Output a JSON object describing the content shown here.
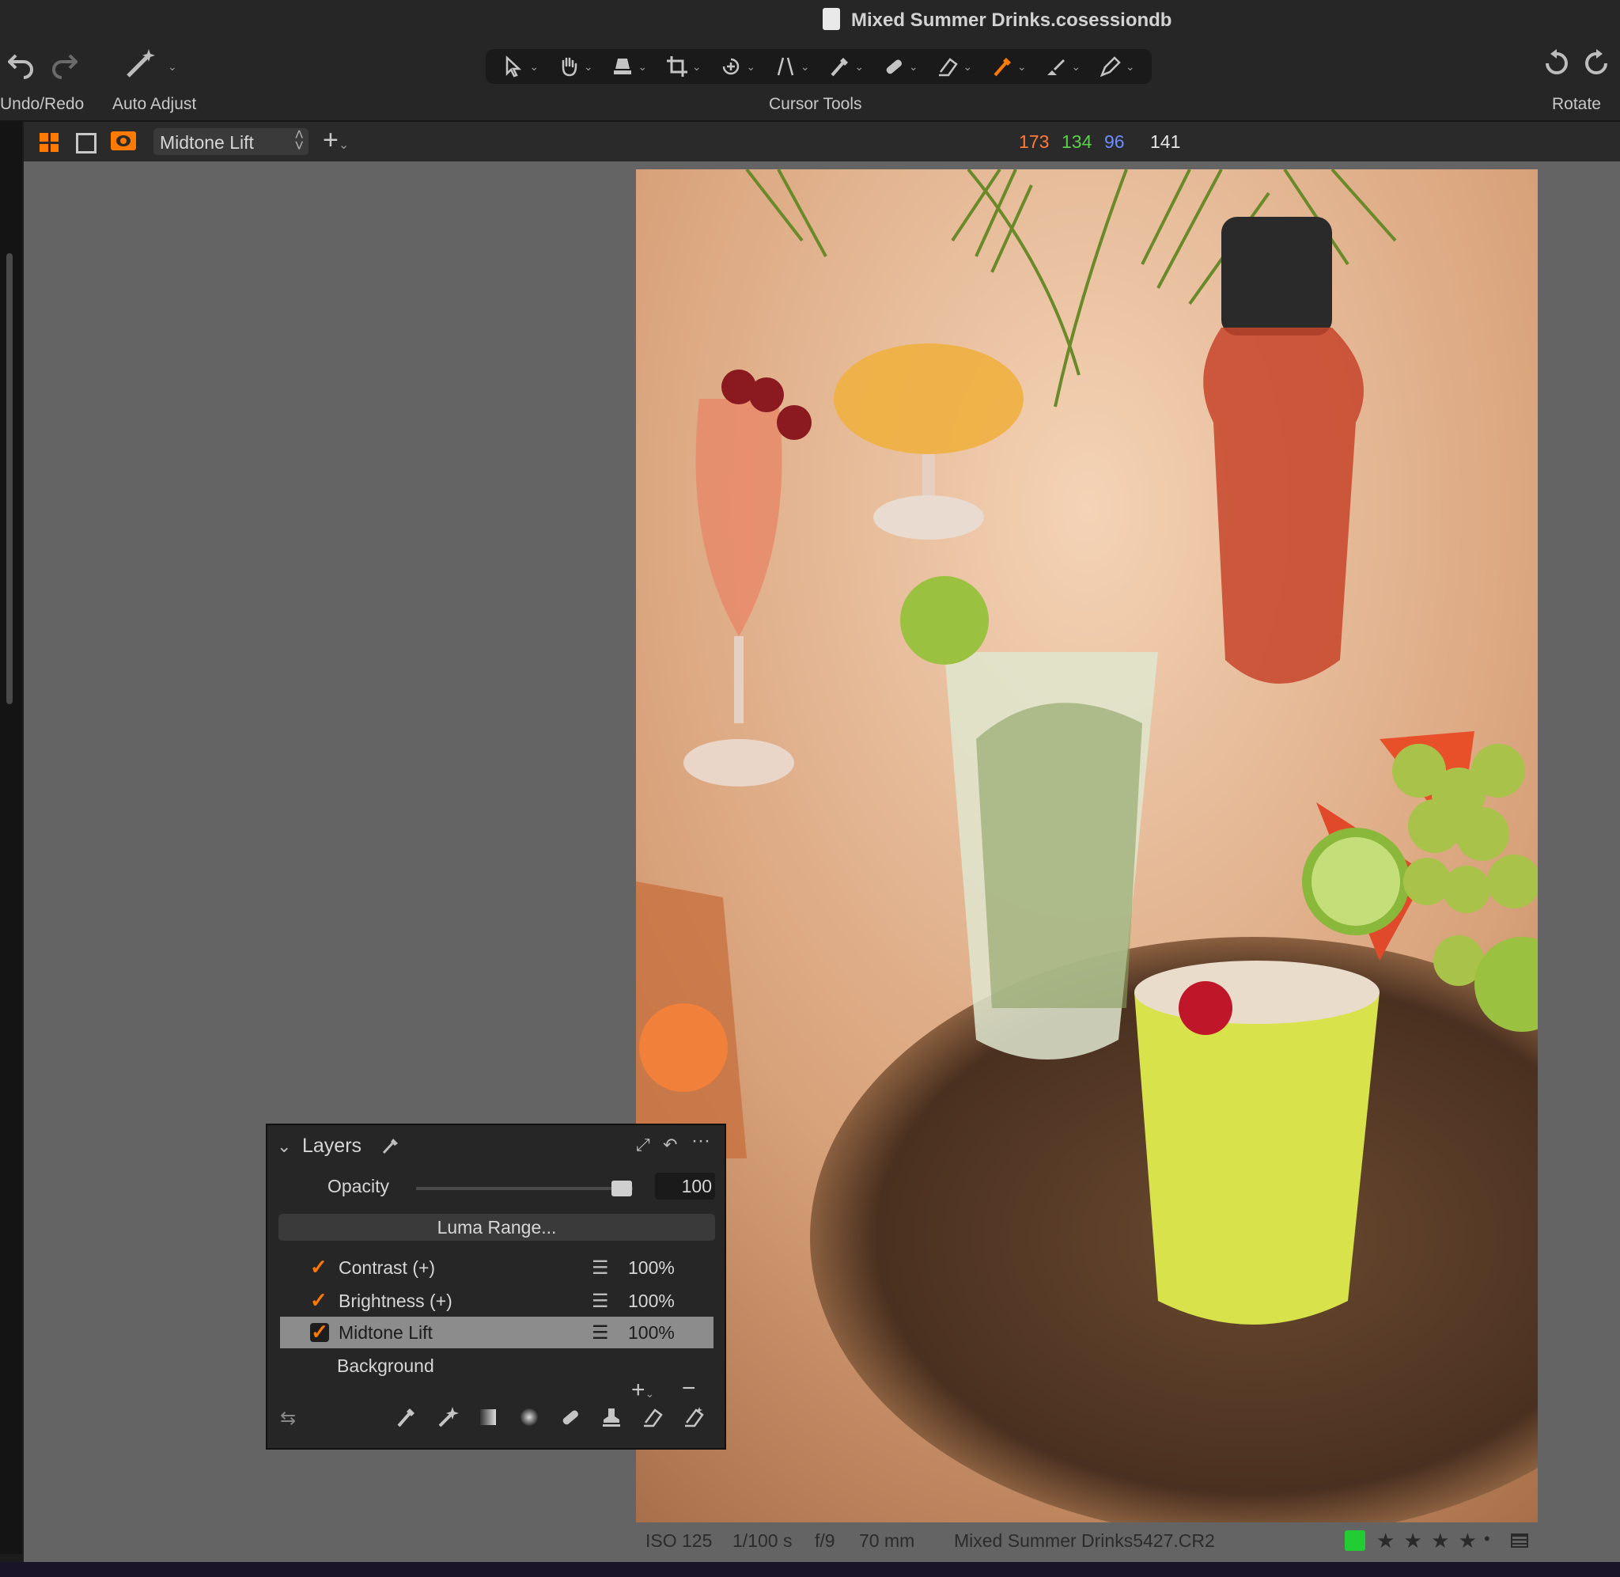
{
  "window": {
    "title": "Mixed Summer Drinks.cosessiondb"
  },
  "toolbar": {
    "undo_redo_label": "Undo/Redo",
    "auto_adjust_label": "Auto Adjust",
    "cursor_tools_label": "Cursor Tools",
    "rotate_label": "Rotate"
  },
  "viewer_bar": {
    "layer_select": "Midtone Lift",
    "readout": {
      "r": "173",
      "g": "134",
      "b": "96",
      "l": "141"
    },
    "colors": {
      "r": "#ff7a3a",
      "g": "#5ccf4a",
      "b": "#6f8cff",
      "l": "#e6e6e6",
      "accent": "#ff7a00"
    }
  },
  "layers_panel": {
    "title": "Layers",
    "opacity_label": "Opacity",
    "opacity_value": "100",
    "opacity_fraction": 0.95,
    "luma_range_button": "Luma Range...",
    "layers": [
      {
        "name": "Contrast (+)",
        "checked": true,
        "opacity": "100%"
      },
      {
        "name": "Brightness (+)",
        "checked": true,
        "opacity": "100%"
      },
      {
        "name": "Midtone Lift",
        "checked": true,
        "opacity": "100%",
        "selected": true
      },
      {
        "name": "Background",
        "checked": false,
        "opacity": ""
      }
    ]
  },
  "info_bar": {
    "iso": "ISO 125",
    "shutter": "1/100 s",
    "aperture": "f/9",
    "focal": "70 mm",
    "filename": "Mixed Summer Drinks5427.CR2",
    "color_tag": "#22cc33",
    "rating": 4,
    "stars": "★ ★ ★ ★"
  }
}
